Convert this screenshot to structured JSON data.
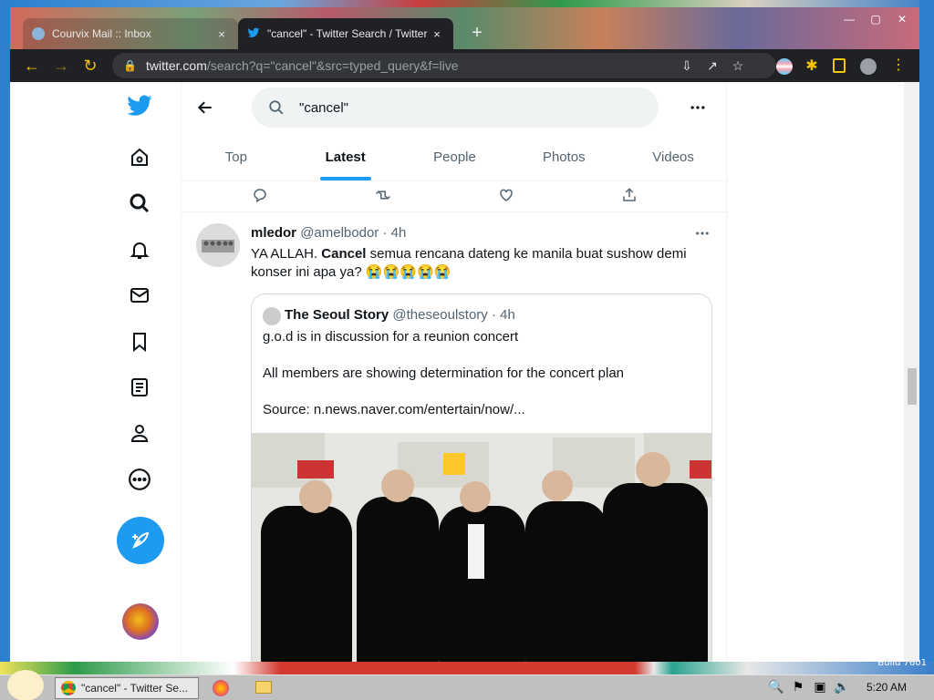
{
  "desktop": {
    "build_label": "Build 7601"
  },
  "browser": {
    "tabs": [
      {
        "title": "Courvix Mail :: Inbox",
        "close": "×"
      },
      {
        "title": "\"cancel\" - Twitter Search / Twitter",
        "close": "×"
      }
    ],
    "new_tab": "+",
    "address": {
      "host": "twitter.com",
      "path": "/search?q=\"cancel\"&src=typed_query&f=live"
    }
  },
  "twitter": {
    "search_value": "\"cancel\"",
    "search_tabs": [
      {
        "label": "Top",
        "active": false
      },
      {
        "label": "Latest",
        "active": true
      },
      {
        "label": "People",
        "active": false
      },
      {
        "label": "Photos",
        "active": false
      },
      {
        "label": "Videos",
        "active": false
      }
    ],
    "tweet": {
      "name": "mledor",
      "handle": "@amelbodor",
      "time": "4h",
      "text_pre": "YA ALLAH. ",
      "text_bold": "Cancel",
      "text_post": " semua rencana dateng ke manila buat sushow demi konser ini apa ya? 😭😭😭😭😭",
      "quote": {
        "name": "The Seoul Story",
        "handle": "@theseoulstory",
        "time": "4h",
        "line1": "g.o.d is in discussion for a reunion concert",
        "line2": "All members are showing determination for the concert plan",
        "line3": "Source: n.news.naver.com/entertain/now/..."
      }
    }
  },
  "taskbar": {
    "chrome_task": "\"cancel\" - Twitter Se...",
    "clock": "5:20 AM"
  },
  "colors": {
    "twitter_blue": "#1d9bf0",
    "chrome_accent": "#f5c400"
  }
}
